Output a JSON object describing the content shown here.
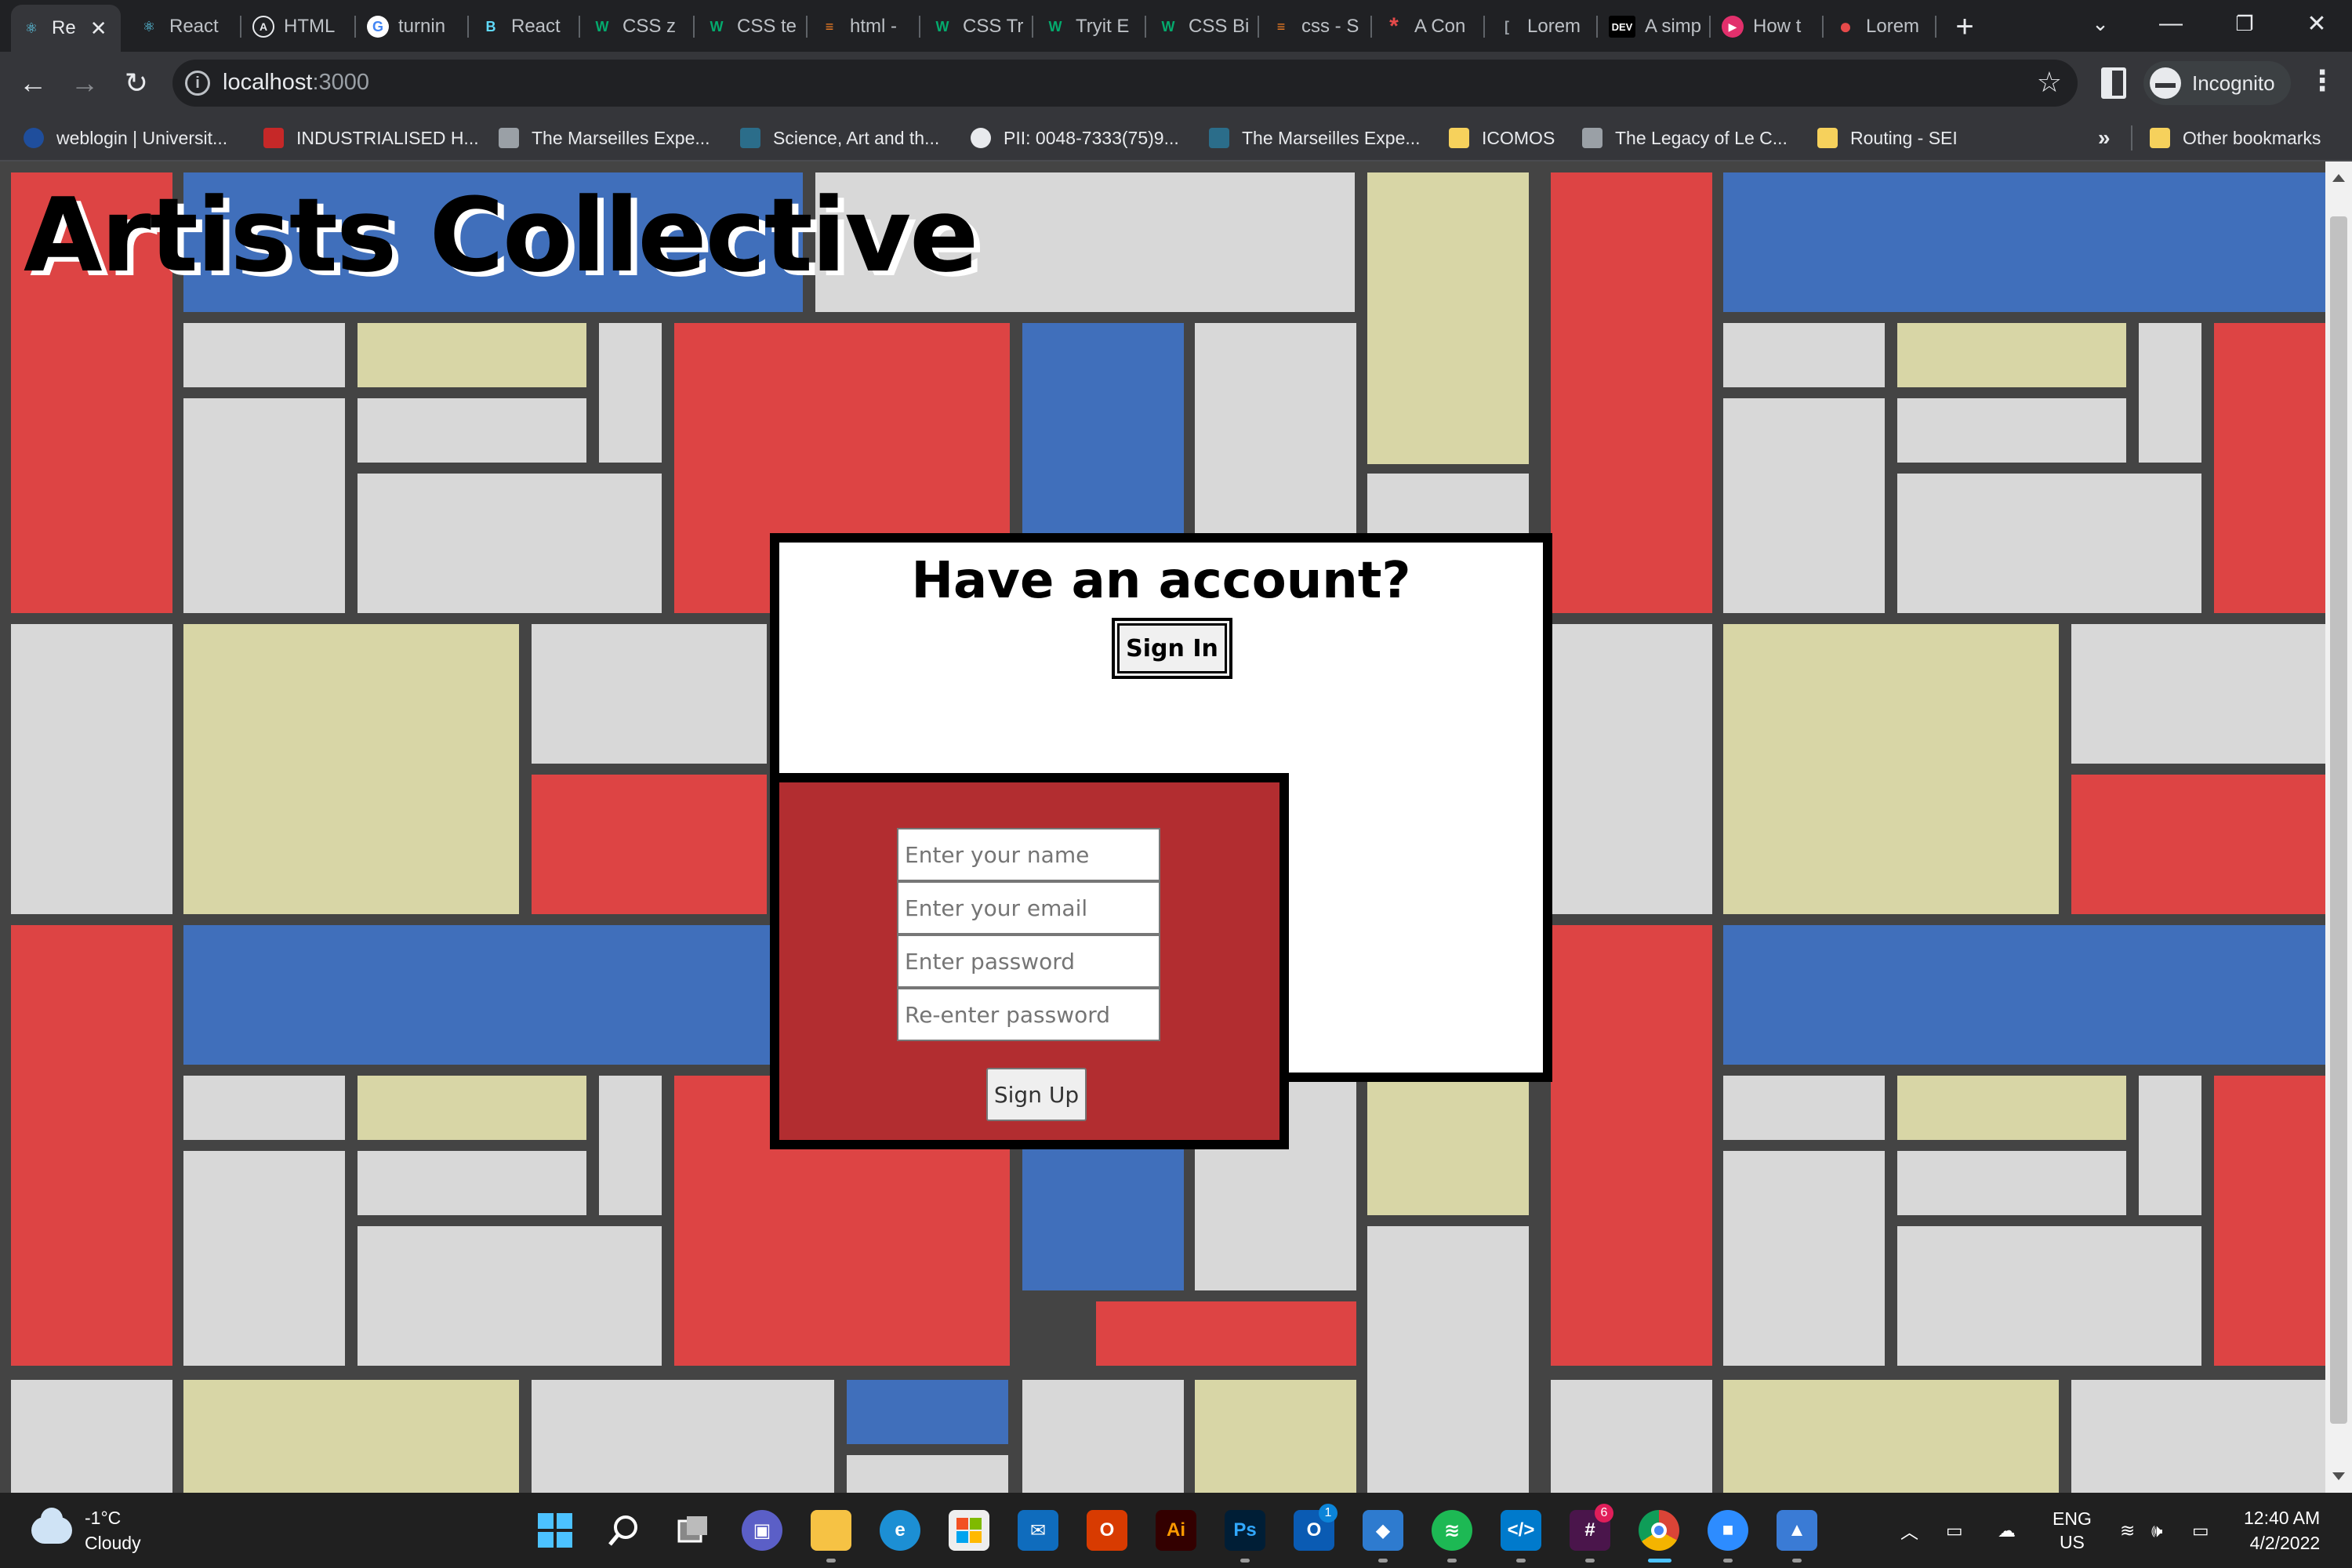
{
  "browser": {
    "tabs": [
      {
        "label": "Re",
        "active": true
      },
      {
        "label": "React"
      },
      {
        "label": "HTML"
      },
      {
        "label": "turnin"
      },
      {
        "label": "React"
      },
      {
        "label": "CSS z"
      },
      {
        "label": "CSS te"
      },
      {
        "label": "html -"
      },
      {
        "label": "CSS Tr"
      },
      {
        "label": "Tryit E"
      },
      {
        "label": "CSS Bi"
      },
      {
        "label": "css - S"
      },
      {
        "label": "A Con"
      },
      {
        "label": "Lorem"
      },
      {
        "label": "A simp"
      },
      {
        "label": "How t"
      },
      {
        "label": "Lorem"
      }
    ],
    "url_host": "localhost",
    "url_port": ":3000",
    "profile_label": "Incognito",
    "bookmarks": [
      "weblogin | Universit...",
      "INDUSTRIALISED H...",
      "The Marseilles Expe...",
      "Science, Art and th...",
      "PII: 0048-7333(75)9...",
      "The Marseilles Expe...",
      "ICOMOS",
      "The Legacy of Le C...",
      "Routing - SEI"
    ],
    "other_bookmarks": "Other bookmarks",
    "dev_badge": "DEV"
  },
  "page": {
    "title": "Artists Collective",
    "login": {
      "heading": "Have an account?",
      "sign_in_label": "Sign In"
    },
    "signup": {
      "name_placeholder": "Enter your name",
      "email_placeholder": "Enter your email",
      "password_placeholder": "Enter password",
      "reenter_placeholder": "Re-enter password",
      "sign_up_label": "Sign Up"
    },
    "colors": {
      "red": "#dd4444",
      "blue": "#406fbb",
      "yellow": "#d8d6a6",
      "grey": "#d8d8d8",
      "grid": "#444444",
      "signup_bg": "#b22d30"
    }
  },
  "taskbar": {
    "temperature": "-1°C",
    "weather": "Cloudy",
    "language_line1": "ENG",
    "language_line2": "US",
    "time": "12:40 AM",
    "date": "4/2/2022",
    "mail_badge": "1",
    "slack_badge": "6"
  }
}
